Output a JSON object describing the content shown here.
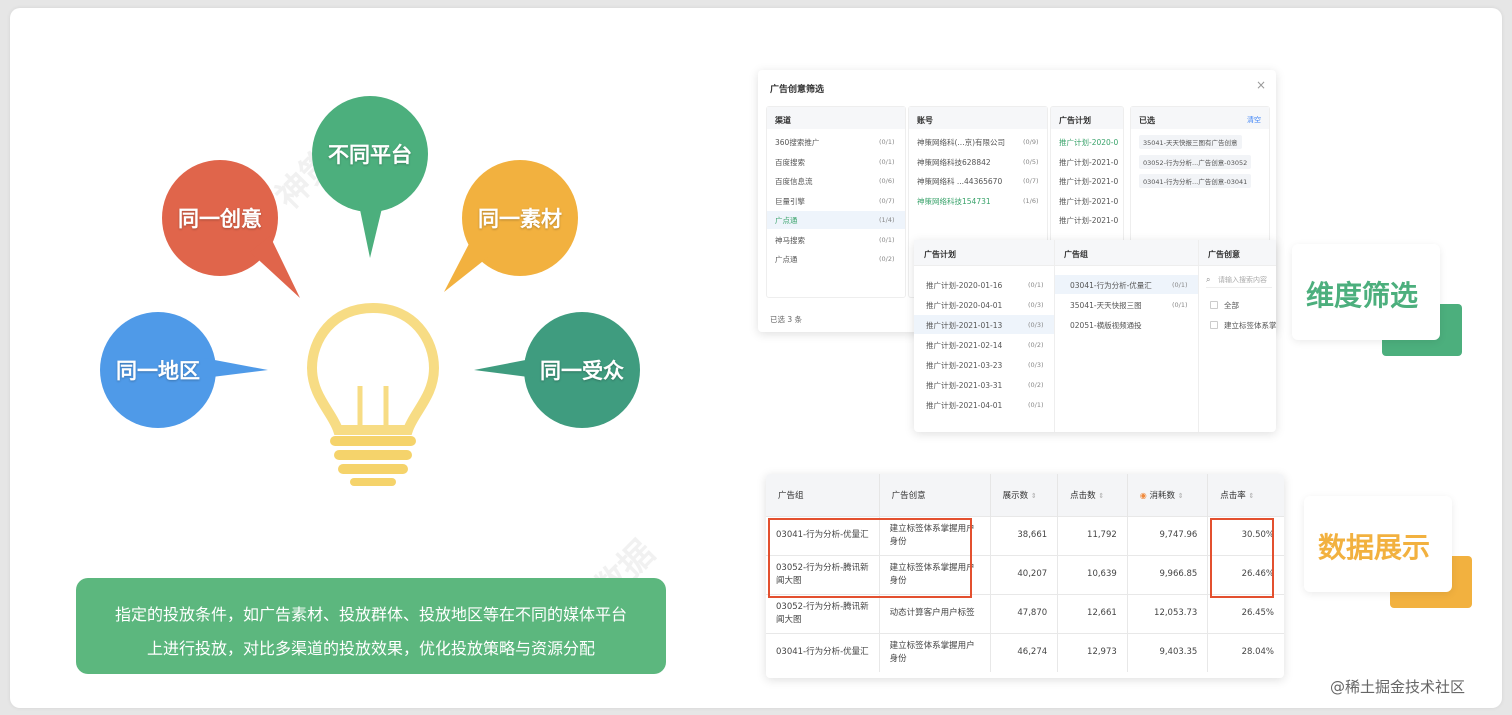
{
  "bubbles": {
    "top": "不同平台",
    "left_top": "同一创意",
    "right_top": "同一素材",
    "left": "同一地区",
    "right": "同一受众"
  },
  "caption": {
    "line1": "指定的投放条件，如广告素材、投放群体、投放地区等在不同的媒体平台",
    "line2": "上进行投放，对比多渠道的投放效果，优化投放策略与资源分配"
  },
  "dialog": {
    "title": "广告创意筛选",
    "close": "×",
    "footer": "已选 3 条",
    "channel": {
      "header": "渠道",
      "items": [
        {
          "label": "360搜索推广",
          "count": "(0/1)"
        },
        {
          "label": "百度搜索",
          "count": "(0/1)"
        },
        {
          "label": "百度信息流",
          "count": "(0/6)"
        },
        {
          "label": "巨量引擎",
          "count": "(0/7)"
        },
        {
          "label": "广点通",
          "count": "(1/4)"
        },
        {
          "label": "神马搜索",
          "count": "(0/1)"
        },
        {
          "label": "广点通",
          "count": "(0/2)"
        }
      ]
    },
    "account": {
      "header": "账号",
      "items": [
        {
          "label": "神策网络科(...京)有限公司",
          "count": "(0/9)"
        },
        {
          "label": "神策网络科技628842",
          "count": "(0/5)"
        },
        {
          "label": "神策网络科 ...44365670",
          "count": "(0/7)"
        },
        {
          "label": "神策网络科技154731",
          "count": "(1/6)"
        }
      ]
    },
    "plan_top": {
      "header": "广告计划",
      "items": [
        "推广计划-2020-0",
        "推广计划-2021-0",
        "推广计划-2021-0",
        "推广计划-2021-0",
        "推广计划-2021-0"
      ]
    },
    "selected": {
      "header": "已选",
      "clear": "清空",
      "items": [
        "35041-天天快报三图有广告创意",
        "03052-行为分析...广告创意-03052",
        "03041-行为分析...广告创意-03041"
      ]
    }
  },
  "popup": {
    "plan": {
      "header": "广告计划",
      "items": [
        {
          "label": "推广计划-2020-01-16",
          "count": "(0/1)"
        },
        {
          "label": "推广计划-2020-04-01",
          "count": "(0/3)"
        },
        {
          "label": "推广计划-2021-01-13",
          "count": "(0/3)"
        },
        {
          "label": "推广计划-2021-02-14",
          "count": "(0/2)"
        },
        {
          "label": "推广计划-2021-03-23",
          "count": "(0/3)"
        },
        {
          "label": "推广计划-2021-03-31",
          "count": "(0/2)"
        },
        {
          "label": "推广计划-2021-04-01",
          "count": "(0/1)"
        }
      ]
    },
    "group": {
      "header": "广告组",
      "items": [
        {
          "label": "03041-行为分析-优量汇",
          "count": "(0/1)"
        },
        {
          "label": "35041-天天快报三图",
          "count": "(0/1)"
        },
        {
          "label": "02051-横版视频通投",
          "count": "(0/1)"
        }
      ]
    },
    "creative": {
      "header": "广告创意",
      "search_placeholder": "请输入搜索内容",
      "items": [
        "全部",
        "建立标签体系掌"
      ]
    }
  },
  "labels": {
    "filter": "维度筛选",
    "display": "数据展示"
  },
  "table": {
    "headers": [
      "广告组",
      "广告创意",
      "展示数",
      "点击数",
      "消耗数",
      "点击率"
    ],
    "rows": [
      [
        "03041-行为分析-优量汇",
        "建立标签体系掌握用户身份",
        "38,661",
        "11,792",
        "9,747.96",
        "30.50%"
      ],
      [
        "03052-行为分析-腾讯新闻大图",
        "建立标签体系掌握用户身份",
        "40,207",
        "10,639",
        "9,966.85",
        "26.46%"
      ],
      [
        "03052-行为分析-腾讯新闻大图",
        "动态计算客户用户标签",
        "47,870",
        "12,661",
        "12,053.73",
        "26.45%"
      ],
      [
        "03041-行为分析-优量汇",
        "建立标签体系掌握用户身份",
        "46,274",
        "12,973",
        "9,403.35",
        "28.04%"
      ]
    ]
  },
  "watermark": {
    "text": "神策数据",
    "sub": "SENSORS Data"
  },
  "credit": "@稀土掘金技术社区",
  "colors": {
    "top": "#4caf7d",
    "left_top": "#e0654b",
    "right_top": "#f2b13f",
    "left": "#4f9ae8",
    "right": "#3f9c7f",
    "caption_bg": "#5cb77e",
    "highlight": "#e3502f",
    "label_green": "#4caf7d",
    "label_yellow": "#f2b13f"
  }
}
